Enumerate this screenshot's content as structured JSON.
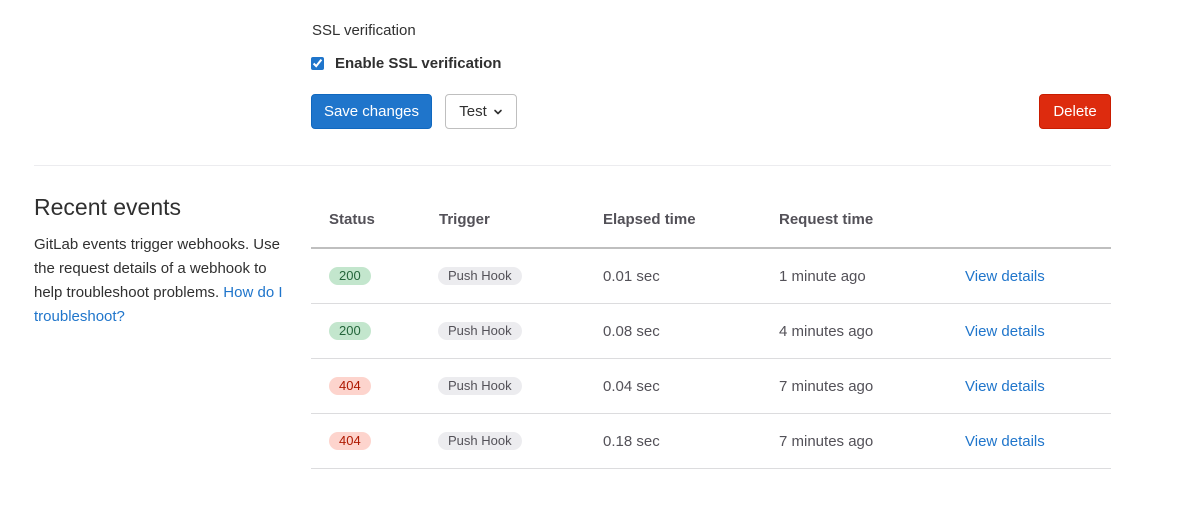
{
  "ssl": {
    "title": "SSL verification",
    "checkbox_label": "Enable SSL verification",
    "checked": true
  },
  "actions": {
    "save_label": "Save changes",
    "test_label": "Test",
    "delete_label": "Delete"
  },
  "events": {
    "heading": "Recent events",
    "description": "GitLab events trigger webhooks. Use the request details of a webhook to help troubleshoot problems.",
    "help_link": "How do I troubleshoot?",
    "columns": [
      "Status",
      "Trigger",
      "Elapsed time",
      "Request time"
    ],
    "rows": [
      {
        "status": "200",
        "trigger": "Push Hook",
        "elapsed": "0.01 sec",
        "request_time": "1 minute ago",
        "action": "View details"
      },
      {
        "status": "200",
        "trigger": "Push Hook",
        "elapsed": "0.08 sec",
        "request_time": "4 minutes ago",
        "action": "View details"
      },
      {
        "status": "404",
        "trigger": "Push Hook",
        "elapsed": "0.04 sec",
        "request_time": "7 minutes ago",
        "action": "View details"
      },
      {
        "status": "404",
        "trigger": "Push Hook",
        "elapsed": "0.18 sec",
        "request_time": "7 minutes ago",
        "action": "View details"
      }
    ]
  },
  "colors": {
    "primary": "#1f75cb",
    "danger": "#dd2b0e",
    "success_badge": "#c3e6cd",
    "error_badge": "#fdd4cd"
  },
  "icons": {
    "test_dropdown": "chevron-down-icon"
  }
}
